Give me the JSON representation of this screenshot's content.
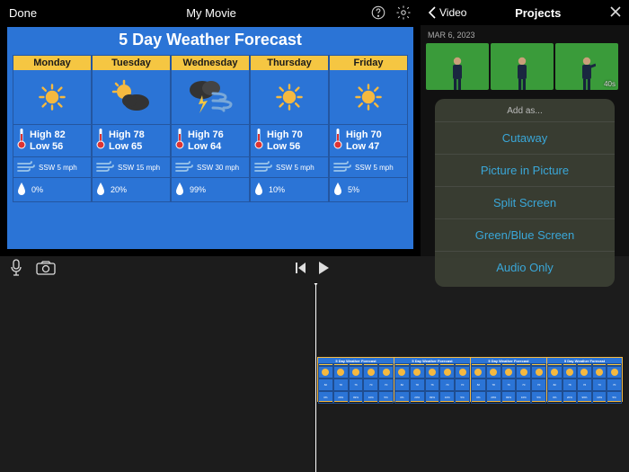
{
  "header": {
    "done": "Done",
    "title": "My Movie"
  },
  "forecast": {
    "title": "5 Day Weather Forecast",
    "days": [
      {
        "name": "Monday",
        "icon": "sun",
        "high": "High 82",
        "low": "Low 56",
        "wind": "SSW 5 mph",
        "precip": "0%"
      },
      {
        "name": "Tuesday",
        "icon": "cloudy",
        "high": "High 78",
        "low": "Low 65",
        "wind": "SSW 15 mph",
        "precip": "20%"
      },
      {
        "name": "Wednesday",
        "icon": "storm",
        "high": "High 76",
        "low": "Low 64",
        "wind": "SSW 30 mph",
        "precip": "99%"
      },
      {
        "name": "Thursday",
        "icon": "sun",
        "high": "High 70",
        "low": "Low 56",
        "wind": "SSW 5 mph",
        "precip": "10%"
      },
      {
        "name": "Friday",
        "icon": "sun",
        "high": "High 70",
        "low": "Low 47",
        "wind": "SSW 5 mph",
        "precip": "5%"
      }
    ]
  },
  "side": {
    "back": "Video",
    "title": "Projects",
    "date": "MAR 6, 2023",
    "thumbs": [
      {
        "dur": ""
      },
      {
        "dur": ""
      },
      {
        "dur": "40s"
      }
    ],
    "popup": {
      "title": "Add as...",
      "options": [
        "Cutaway",
        "Picture in Picture",
        "Split Screen",
        "Green/Blue Screen",
        "Audio Only"
      ]
    }
  }
}
